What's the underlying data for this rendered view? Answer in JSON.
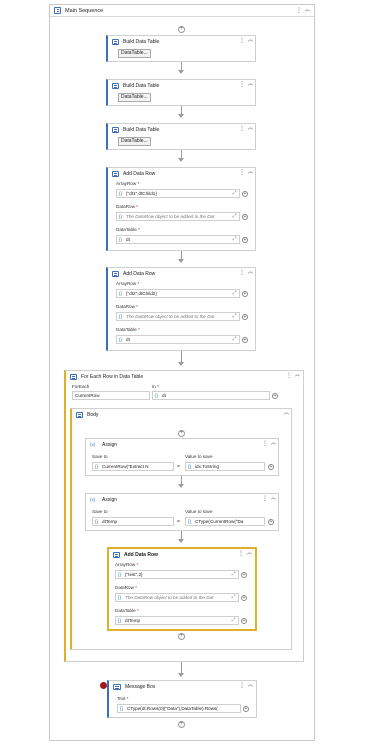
{
  "main_sequence": {
    "title": "Main Sequence",
    "dots": "⋮",
    "collapse": "︽"
  },
  "symbols": {
    "plus": "+",
    "dots": "⋮",
    "collapse": "︽",
    "expand": "⤢",
    "brace": "{}",
    "equals": "=",
    "assign_icon": "(x)"
  },
  "build_tables": [
    {
      "title": "Build Data Table",
      "button": "DataTable..."
    },
    {
      "title": "Build Data Table",
      "button": "DataTable..."
    },
    {
      "title": "Build Data Table",
      "button": "DataTable..."
    }
  ],
  "add_rows": [
    {
      "title": "Add Data Row",
      "array_row_label": "ArrayRow",
      "array_row_value": "{\"dt1\",dtChild1}",
      "data_row_label": "DataRow",
      "data_row_placeholder": "The DataRow object to be added to the Dat",
      "data_table_label": "DataTable",
      "data_table_value": "dt"
    },
    {
      "title": "Add Data Row",
      "array_row_label": "ArrayRow",
      "array_row_value": "{\"dt2\",dtChild2}",
      "data_row_label": "DataRow",
      "data_row_placeholder": "The DataRow object to be added to the Dat",
      "data_table_label": "DataTable",
      "data_table_value": "dt"
    }
  ],
  "foreach": {
    "title": "For Each Row in Data Table",
    "foreach_label": "ForEach",
    "foreach_value": "CurrentRow",
    "in_label": "In",
    "in_value": "dt",
    "body_title": "Body"
  },
  "assigns": [
    {
      "title": "Assign",
      "save_to_label": "Save to",
      "save_to_value": "CurrentRow(\"Extract N",
      "value_label": "Value to save",
      "value_value": "idx.ToString"
    },
    {
      "title": "Assign",
      "save_to_label": "Save to",
      "save_to_value": "dtTemp",
      "value_label": "Value to save",
      "value_value": "CType(CurrentRow(\"Da"
    }
  ],
  "inner_add_row": {
    "title": "Add Data Row",
    "array_row_label": "ArrayRow",
    "array_row_value": "{\"test\",2}",
    "data_row_label": "DataRow",
    "data_row_placeholder": "The DataRow object to be added to the Dat",
    "data_table_label": "DataTable",
    "data_table_value": "dtTemp"
  },
  "message_box": {
    "title": "Message Box",
    "text_label": "Text",
    "text_value": "CType(dt.Rows(0)(\"Data\"),DataTable).Rows("
  },
  "colors": {
    "accent_blue": "#3b6fb6",
    "selected_border": "#e0b02b",
    "breakpoint": "#a4161a"
  }
}
